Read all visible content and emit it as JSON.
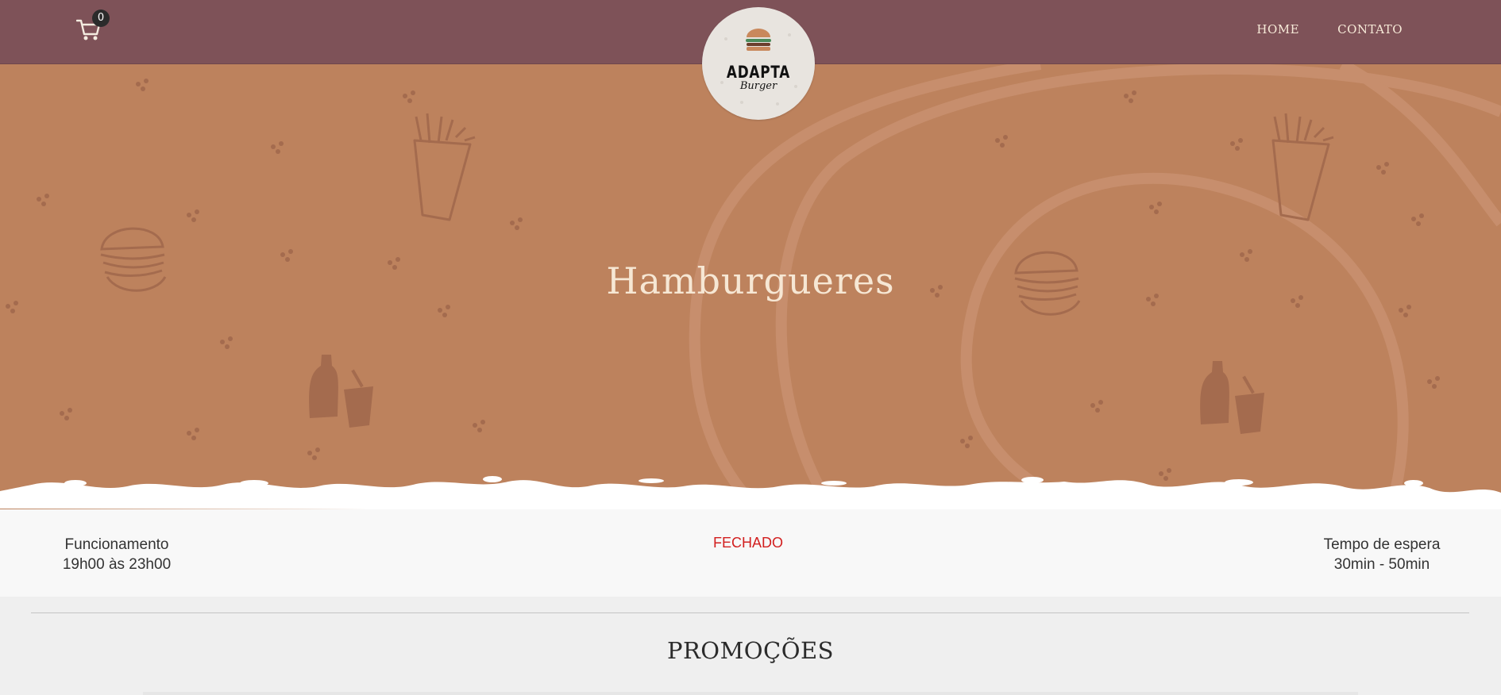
{
  "header": {
    "cart_icon": "shopping-cart-icon",
    "cart_count": "0",
    "nav": [
      "HOME",
      "CONTATO"
    ],
    "logo_icon": "burger-logo-icon",
    "logo_text": {
      "brand": "ADAPTA",
      "sub": "Burger"
    }
  },
  "hero": {
    "title": "Hamburgueres",
    "decoration_icons": [
      "fries-icon",
      "burger-icon",
      "soda-bottle-icon",
      "cup-with-straw-icon"
    ]
  },
  "info": {
    "hours_label": "Funcionamento",
    "hours_value": "19h00 às 23h00",
    "status": "FECHADO",
    "wait_label": "Tempo de espera",
    "wait_value": "30min - 50min"
  },
  "sections": {
    "promo_title": "PROMOÇÕES"
  },
  "colors": {
    "topbar": "#7e5258",
    "hero": "#bd825d",
    "hero_title": "#f6e7d4",
    "status_closed": "#d21f1f"
  }
}
